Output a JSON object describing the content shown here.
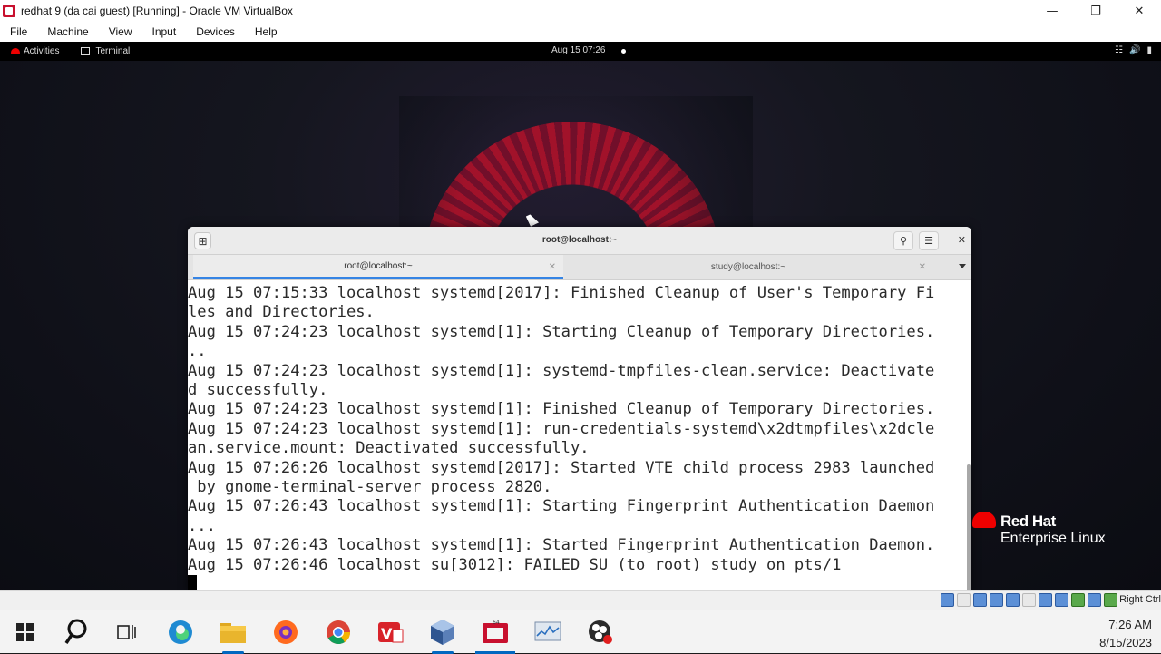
{
  "vbox": {
    "title": "redhat 9 (da cai guest) [Running] - Oracle VM VirtualBox",
    "menu": [
      "File",
      "Machine",
      "View",
      "Input",
      "Devices",
      "Help"
    ],
    "host_key": "Right Ctrl"
  },
  "gnome": {
    "activities": "Activities",
    "app_name": "Terminal",
    "clock": "Aug 15  07:26"
  },
  "terminal": {
    "title": "root@localhost:~",
    "tabs": [
      {
        "label": "root@localhost:~",
        "active": true
      },
      {
        "label": "study@localhost:~",
        "active": false
      }
    ],
    "lines": [
      "Aug 15 07:15:33 localhost systemd[2017]: Finished Cleanup of User's Temporary Fi",
      "les and Directories.",
      "Aug 15 07:24:23 localhost systemd[1]: Starting Cleanup of Temporary Directories.",
      "..",
      "Aug 15 07:24:23 localhost systemd[1]: systemd-tmpfiles-clean.service: Deactivate",
      "d successfully.",
      "Aug 15 07:24:23 localhost systemd[1]: Finished Cleanup of Temporary Directories.",
      "Aug 15 07:24:23 localhost systemd[1]: run-credentials-systemd\\x2dtmpfiles\\x2dcle",
      "an.service.mount: Deactivated successfully.",
      "Aug 15 07:26:26 localhost systemd[2017]: Started VTE child process 2983 launched",
      " by gnome-terminal-server process 2820.",
      "Aug 15 07:26:43 localhost systemd[1]: Starting Fingerprint Authentication Daemon",
      "...",
      "Aug 15 07:26:43 localhost systemd[1]: Started Fingerprint Authentication Daemon.",
      "Aug 15 07:26:46 localhost su[3012]: FAILED SU (to root) study on pts/1"
    ]
  },
  "logo": {
    "brand": "Red Hat",
    "product": "Enterprise Linux"
  },
  "taskbar": {
    "time": "7:26 AM",
    "date": "8/15/2023",
    "apps": [
      "windows-start",
      "search",
      "task-view",
      "edge",
      "file-explorer",
      "firefox",
      "chrome",
      "vmware",
      "virtualbox",
      "vm-window",
      "monitor",
      "obs"
    ]
  }
}
